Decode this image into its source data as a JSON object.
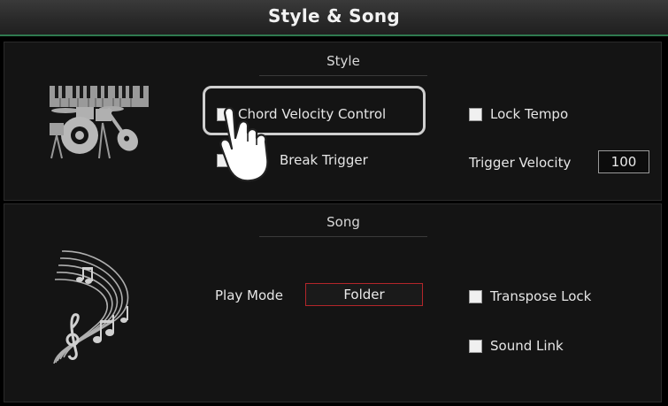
{
  "header": {
    "title": "Style & Song"
  },
  "style_section": {
    "title": "Style",
    "icon": "drum-keyboard-guitar-icon",
    "chord_velocity_control": {
      "label": "Chord Velocity Control",
      "checked": false
    },
    "break_trigger": {
      "label": "Break Trigger",
      "checked": false
    },
    "lock_tempo": {
      "label": "Lock Tempo",
      "checked": false
    },
    "trigger_velocity": {
      "label": "Trigger Velocity",
      "value": "100"
    }
  },
  "song_section": {
    "title": "Song",
    "icon": "music-staff-icon",
    "play_mode": {
      "label": "Play Mode",
      "value": "Folder"
    },
    "transpose_lock": {
      "label": "Transpose Lock",
      "checked": false
    },
    "sound_link": {
      "label": "Sound Link",
      "checked": false
    }
  },
  "overlay": {
    "icon": "tap-hand-icon"
  },
  "colors": {
    "accent": "#2f7a4f",
    "selected_border": "#b3262a",
    "highlight": "#cfcfcf"
  }
}
